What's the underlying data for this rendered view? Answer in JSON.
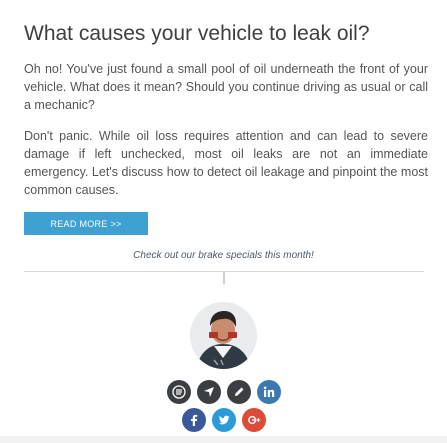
{
  "article": {
    "title": "What causes your vehicle to leak oil?",
    "paragraphs": [
      "Oh no! You've just found a small pool of oil underneath the front of your vehicle. What does it mean? Should you continue driving as usual or call a mechanic?",
      "Don't panic. While oil loss requires attention and can lead to severe damage if left unchecked, most oil leaks are not an immediate emergency. Let's discuss how to detect oil leakage and pinpoint the most common causes."
    ],
    "read_more_label": "READ MORE >>",
    "specials_link": "Check out our brake specials this month!"
  },
  "author": {
    "avatar": "author-avatar-photo"
  },
  "author_icons": [
    "blog-icon",
    "location-pin-icon",
    "pencil-icon",
    "linkedin-icon"
  ],
  "social_icons": [
    "facebook-icon",
    "twitter-icon",
    "google-plus-icon"
  ],
  "colors": {
    "accent": "#3fa0d2",
    "dark_icon": "#3b3f44",
    "linkedin": "#3b79b0",
    "facebook": "#3b5998",
    "twitter": "#2b9ad8",
    "google_plus": "#dd4b39"
  }
}
